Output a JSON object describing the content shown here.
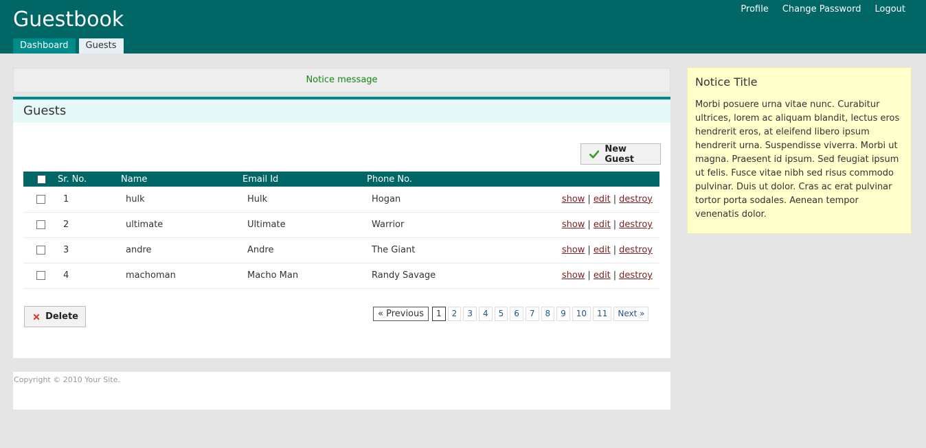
{
  "header": {
    "title": "Guestbook",
    "user_nav": [
      "Profile",
      "Change Password",
      "Logout"
    ],
    "tabs": [
      "Dashboard",
      "Guests"
    ],
    "active_tab": "Guests"
  },
  "notice": {
    "message": "Notice message"
  },
  "main": {
    "heading": "Guests",
    "new_button": "New Guest",
    "delete_button": "Delete",
    "columns": [
      "Sr. No.",
      "Name",
      "Email Id",
      "Phone No."
    ],
    "rows": [
      {
        "sr": "1",
        "name": "hulk",
        "email": "Hulk",
        "phone": "Hogan"
      },
      {
        "sr": "2",
        "name": "ultimate",
        "email": "Ultimate",
        "phone": "Warrior"
      },
      {
        "sr": "3",
        "name": "andre",
        "email": "Andre",
        "phone": "The Giant"
      },
      {
        "sr": "4",
        "name": "machoman",
        "email": "Macho Man",
        "phone": "Randy Savage"
      }
    ],
    "actions": {
      "show": "show",
      "edit": "edit",
      "destroy": "destroy",
      "separator": "|"
    },
    "pagination": {
      "previous": "« Previous",
      "pages": [
        "1",
        "2",
        "3",
        "4",
        "5",
        "6",
        "7",
        "8",
        "9",
        "10",
        "11"
      ],
      "current": "1",
      "next": "Next »"
    }
  },
  "footer": {
    "text": "Copyright © 2010 Your Site."
  },
  "sidebar": {
    "title": "Notice Title",
    "body": "Morbi posuere urna vitae nunc. Curabitur ultrices, lorem ac aliquam blandit, lectus eros hendrerit eros, at eleifend libero ipsum hendrerit urna. Suspendisse viverra. Morbi ut magna. Praesent id ipsum. Sed feugiat ipsum ut felis. Fusce vitae nibh sed risus commodo pulvinar. Duis ut dolor. Cras ac erat pulvinar tortor porta sodales. Aenean tempor venenatis dolor."
  },
  "colors": {
    "header_bg": "#006666",
    "accent": "#008b8b",
    "action_link": "#7a1f1f",
    "notice_text": "#118811",
    "sidebar_bg": "#ffffcc"
  },
  "icons": {
    "new_button": "checkmark-icon",
    "delete_button": "red-x-icon"
  }
}
